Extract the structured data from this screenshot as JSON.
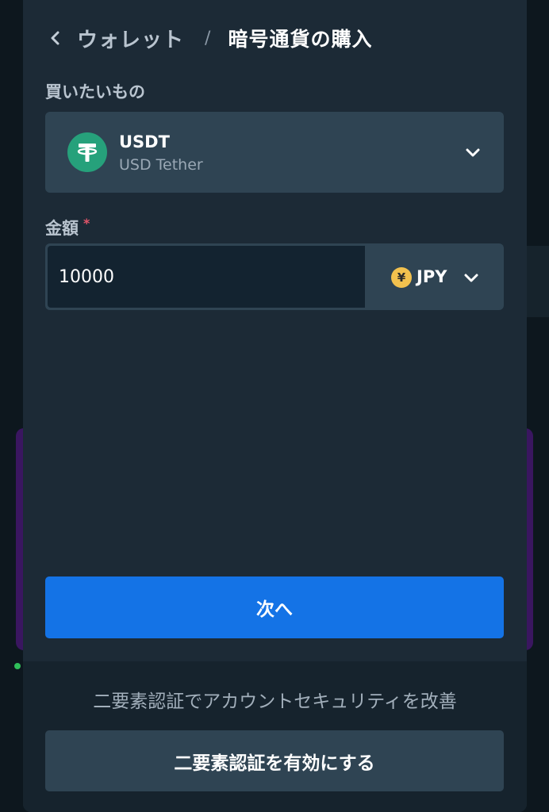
{
  "header": {
    "back_link": "ウォレット",
    "separator": "/",
    "title": "暗号通貨の購入"
  },
  "asset": {
    "label": "買いたいもの",
    "symbol": "USDT",
    "name": "USD Tether",
    "icon": "tether-icon"
  },
  "amount": {
    "label": "金額",
    "required_mark": "*",
    "value": "10000",
    "currency": "JPY",
    "currency_symbol": "¥"
  },
  "actions": {
    "next_label": "次へ"
  },
  "footer": {
    "message": "二要素認証でアカウントセキュリティを改善",
    "enable_2fa_label": "二要素認証を有効にする"
  },
  "colors": {
    "primary": "#1473e6",
    "tether": "#26a17b",
    "yen": "#f2c14e",
    "required": "#e2556a"
  }
}
